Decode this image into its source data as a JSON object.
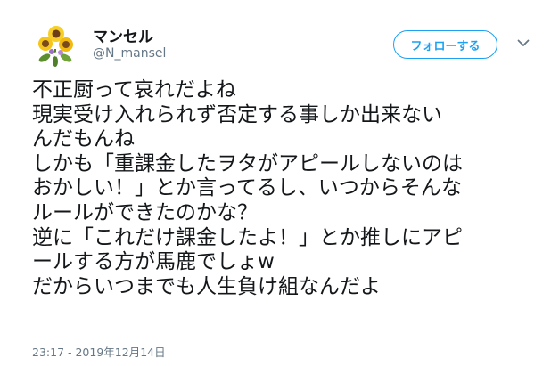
{
  "tweet": {
    "user": {
      "name": "マンセル",
      "handle": "@N_mansel",
      "avatar_icon": "sunflower-bouquet-icon"
    },
    "follow_label": "フォローする",
    "menu_icon": "chevron-down-icon",
    "text_lines": [
      "不正厨って哀れだよね",
      "現実受け入れられず否定する事しか出来ない",
      "んだもんね",
      "しかも「重課金したヲタがアピールしないのは",
      "おかしい！」とか言ってるし、いつからそんな",
      "ルールができたのかな？",
      "逆に「これだけ課金したよ！」とか推しにアピ",
      "ールする方が馬鹿でしょw",
      "だからいつまでも人生負け組なんだよ"
    ],
    "timestamp": "23:17 - 2019年12月14日"
  },
  "colors": {
    "accent": "#1da1f2",
    "text": "#14171a",
    "secondary": "#657786"
  }
}
